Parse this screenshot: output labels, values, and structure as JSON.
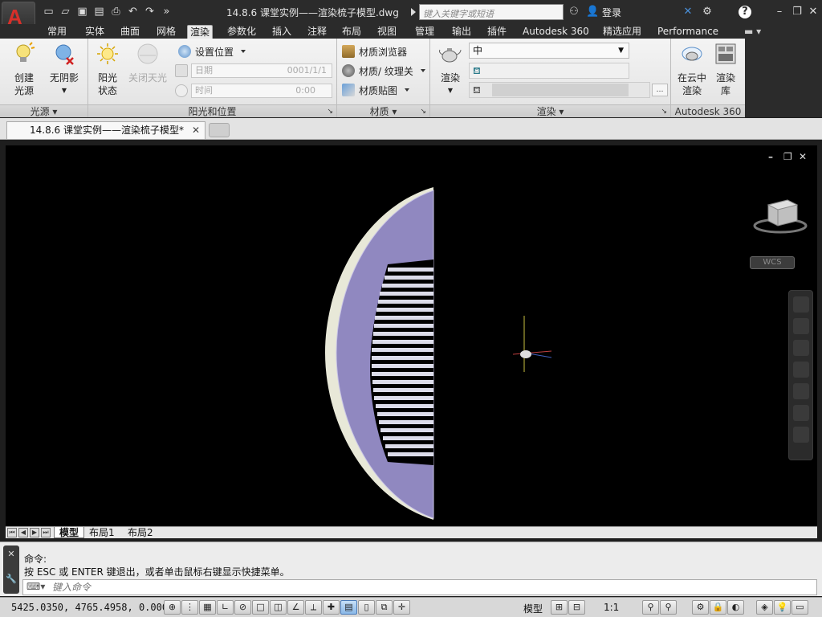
{
  "window": {
    "doc_title": "14.8.6 课堂实例——渲染梳子模型.dwg",
    "search_placeholder": "键入关键字或短语",
    "login_label": "登录"
  },
  "ribbon_tabs": [
    "常用",
    "实体",
    "曲面",
    "网格",
    "渲染",
    "参数化",
    "插入",
    "注释",
    "布局",
    "视图",
    "管理",
    "输出",
    "插件",
    "Autodesk 360",
    "精选应用",
    "Performance"
  ],
  "active_tab": "渲染",
  "panels": {
    "lights": {
      "footer": "光源 ▾",
      "create_light": "创建\n光源",
      "create_light_line1": "创建",
      "create_light_line2": "光源",
      "no_shadow_line1": "无阴影"
    },
    "sun": {
      "footer": "阳光和位置",
      "sun_status_line1": "阳光",
      "sun_status_line2": "状态",
      "sky_off": "关闭天光",
      "set_location": "设置位置",
      "date_label": "日期",
      "date_value": "0001/1/1",
      "time_label": "时间",
      "time_value": "0:00"
    },
    "materials": {
      "footer": "材质 ▾",
      "browser": "材质浏览器",
      "texture": "材质/ 纹理关",
      "mapping": "材质贴图"
    },
    "render": {
      "footer": "渲染 ▾",
      "render_label": "渲染",
      "quality_value": "中"
    },
    "autodesk360": {
      "footer": "Autodesk 360",
      "cloud_line1": "在云中",
      "cloud_line2": "渲染",
      "gallery_line1": "渲染",
      "gallery_line2": "库"
    }
  },
  "doc_tab": {
    "label": "14.8.6 课堂实例——渲染梳子模型*"
  },
  "viewport": {
    "wcs_label": "WCS"
  },
  "layout_tabs": [
    "模型",
    "布局1",
    "布局2"
  ],
  "command": {
    "line1": "命令:",
    "line2": "按 ESC 或 ENTER 键退出，或者单击鼠标右键显示快捷菜单。",
    "input_placeholder": "键入命令"
  },
  "statusbar": {
    "coords": "5425.0350, 4765.4958, 0.0000",
    "model_label": "模型",
    "scale_label": "1:1"
  },
  "colors": {
    "comb_face": "#9088c0",
    "comb_edge": "#e8e8d8",
    "viewport_bg": "#000000",
    "ribbon_bg": "#ececec",
    "app_red": "#d6302a"
  }
}
